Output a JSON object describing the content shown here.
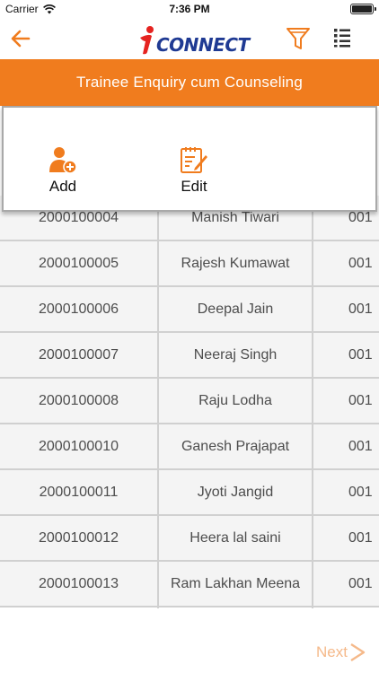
{
  "status_bar": {
    "carrier": "Carrier",
    "time": "7:36 PM"
  },
  "nav": {
    "logo_text": "CONNECT",
    "back_icon": "arrow-left-icon",
    "filter_icon": "filter-icon",
    "menu_icon": "list-menu-icon"
  },
  "header": {
    "title": "Trainee Enquiry cum Counseling"
  },
  "actions": [
    {
      "label": "Add",
      "icon": "add-user-icon"
    },
    {
      "label": "Edit",
      "icon": "edit-note-icon"
    }
  ],
  "table": {
    "rows": [
      {
        "id": "2000100004",
        "name": "Manish Tiwari",
        "code": "001"
      },
      {
        "id": "2000100005",
        "name": "Rajesh Kumawat",
        "code": "001"
      },
      {
        "id": "2000100006",
        "name": "Deepal Jain",
        "code": "001"
      },
      {
        "id": "2000100007",
        "name": "Neeraj Singh",
        "code": "001"
      },
      {
        "id": "2000100008",
        "name": "Raju Lodha",
        "code": "001"
      },
      {
        "id": "2000100010",
        "name": "Ganesh Prajapat",
        "code": "001"
      },
      {
        "id": "2000100011",
        "name": "Jyoti Jangid",
        "code": "001"
      },
      {
        "id": "2000100012",
        "name": "Heera lal saini",
        "code": "001"
      },
      {
        "id": "2000100013",
        "name": "Ram Lakhan Meena",
        "code": "001"
      }
    ]
  },
  "pager": {
    "next_label": "Next"
  },
  "colors": {
    "accent": "#F07C1E",
    "logo_blue": "#1F3A93",
    "logo_red": "#E52320",
    "row_bg": "#F4F4F4",
    "next_disabled": "#F5B98A"
  }
}
